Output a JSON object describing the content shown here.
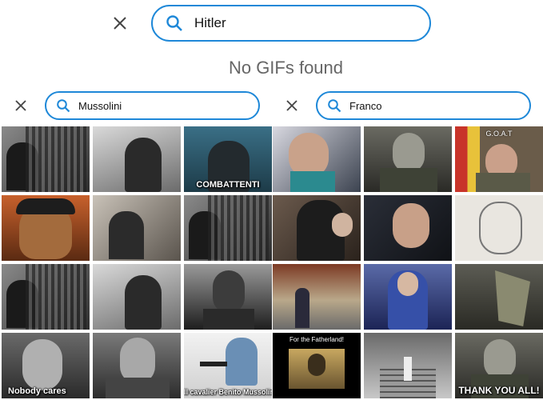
{
  "top_search": {
    "query": "Hitler",
    "no_results": "No GIFs found"
  },
  "left_search": {
    "query": "Mussolini"
  },
  "right_search": {
    "query": "Franco"
  },
  "left_tiles": [
    {
      "caption": "",
      "caption_top": ""
    },
    {
      "caption": "",
      "caption_top": ""
    },
    {
      "caption": "COMBATTENTI",
      "caption_top": ""
    },
    {
      "caption": "",
      "caption_top": ""
    },
    {
      "caption": "",
      "caption_top": ""
    },
    {
      "caption": "",
      "caption_top": ""
    },
    {
      "caption": "",
      "caption_top": ""
    },
    {
      "caption": "",
      "caption_top": ""
    },
    {
      "caption": "",
      "caption_top": ""
    },
    {
      "caption": "Nobody cares",
      "caption_top": ""
    },
    {
      "caption": "",
      "caption_top": ""
    },
    {
      "caption": "Il cavalier Benito Mussolini",
      "caption_top": ""
    }
  ],
  "right_tiles": [
    {
      "caption": "",
      "caption_top": ""
    },
    {
      "caption": "",
      "caption_top": ""
    },
    {
      "caption": "",
      "caption_top": "G.O.A.T"
    },
    {
      "caption": "",
      "caption_top": ""
    },
    {
      "caption": "",
      "caption_top": ""
    },
    {
      "caption": "",
      "caption_top": ""
    },
    {
      "caption": "",
      "caption_top": ""
    },
    {
      "caption": "",
      "caption_top": ""
    },
    {
      "caption": "",
      "caption_top": ""
    },
    {
      "caption": "",
      "caption_top": "For the Fatherland!"
    },
    {
      "caption": "",
      "caption_top": ""
    },
    {
      "caption": "THANK YOU ALL!",
      "caption_top": ""
    }
  ]
}
